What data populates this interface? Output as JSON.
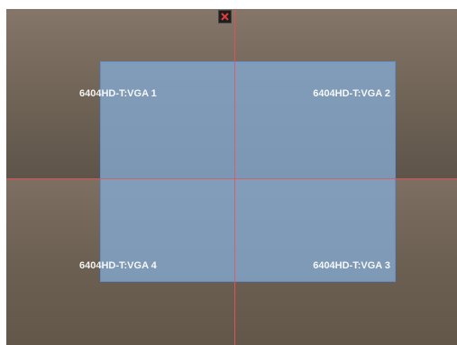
{
  "display_wall": {
    "screens": [
      {
        "label": "6404HD-T:VGA 1"
      },
      {
        "label": "6404HD-T:VGA 2"
      },
      {
        "label": "6404HD-T:VGA 3"
      },
      {
        "label": "6404HD-T:VGA 4"
      }
    ],
    "close_icon": "close-icon",
    "colors": {
      "divider": "#e0505a",
      "selection_fill": "#84aad2",
      "selection_border": "#5f8fd0",
      "close_glyph": "#e23b3b"
    }
  }
}
